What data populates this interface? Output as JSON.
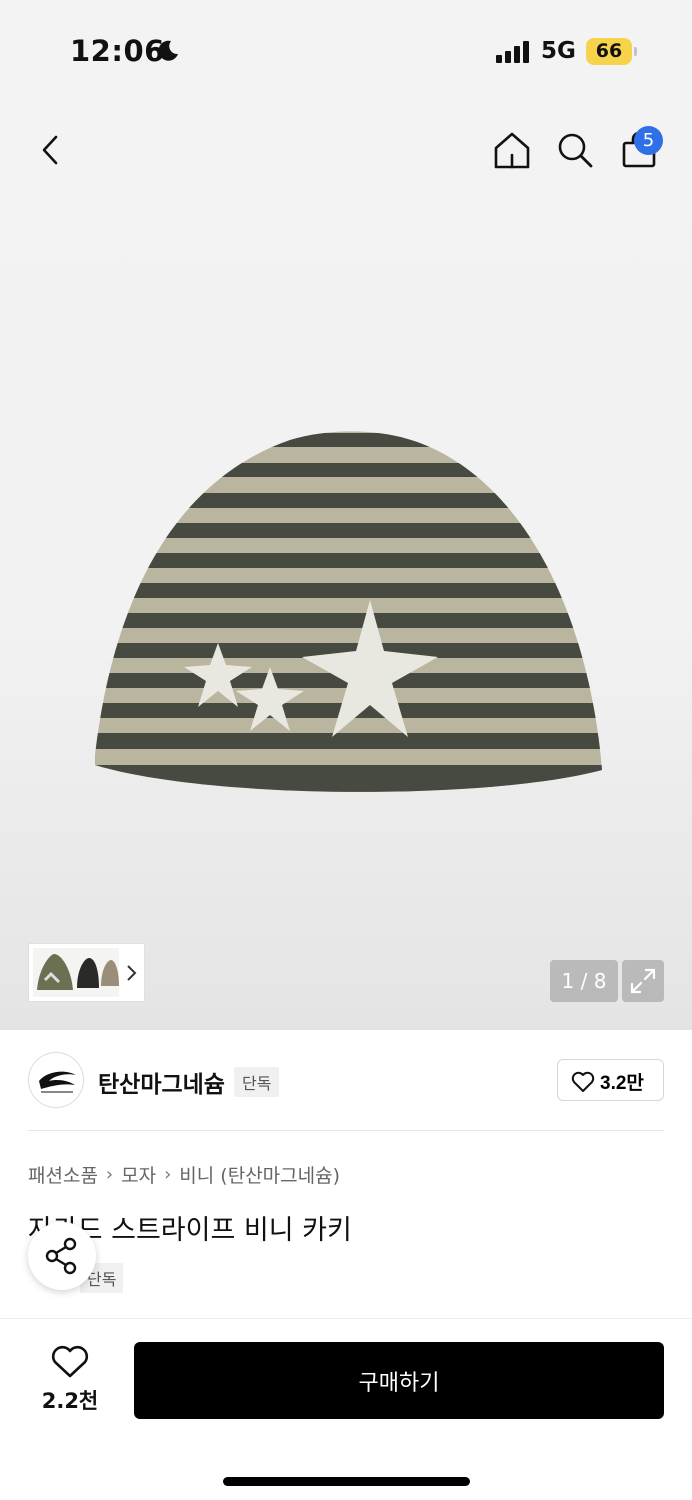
{
  "status_bar": {
    "time": "12:06",
    "network": "5G",
    "battery": "66"
  },
  "nav": {
    "cart_count": "5"
  },
  "gallery": {
    "counter": "1 / 8"
  },
  "brand": {
    "name": "탄산마그네슘",
    "tag": "단독",
    "likes": "3.2만"
  },
  "breadcrumb": [
    "패션소품",
    "모자",
    "비니 (탄산마그네슘)"
  ],
  "product": {
    "title": "자카드 스트라이프 비니 카키",
    "tag": "단독"
  },
  "bottom_bar": {
    "likes": "2.2천",
    "buy_label": "구매하기"
  },
  "colors": {
    "accent_badge": "#2f6fe8",
    "buy_button": "#000000",
    "battery": "#f6d34a"
  },
  "icons": [
    "moon-icon",
    "signal-icon",
    "back-icon",
    "home-icon",
    "search-icon",
    "bag-icon",
    "chevron-right-icon",
    "expand-icon",
    "heart-icon",
    "share-icon"
  ]
}
